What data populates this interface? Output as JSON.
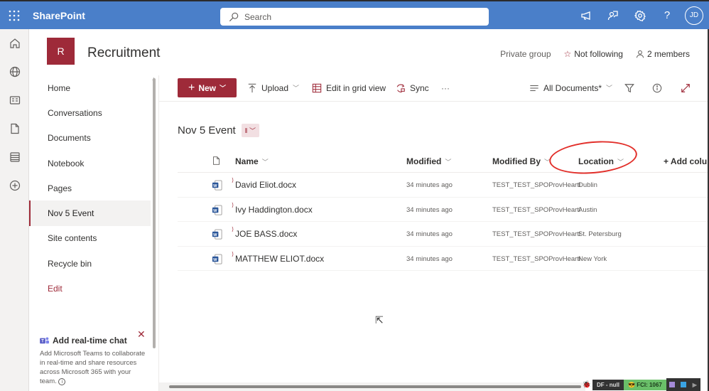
{
  "suitebar": {
    "app_name": "SharePoint",
    "search_placeholder": "Search",
    "icons": [
      "megaphone-icon",
      "feedback-icon",
      "settings-icon",
      "help-icon"
    ],
    "user_initials": "JD"
  },
  "site": {
    "logo_letter": "R",
    "title": "Recruitment",
    "privacy": "Private group",
    "follow_label": "Not following",
    "members_label": "2 members"
  },
  "appbar": {
    "icons": [
      "home-icon",
      "globe-icon",
      "news-icon",
      "file-icon",
      "list-icon",
      "add-circle-icon"
    ]
  },
  "leftnav": {
    "items": [
      {
        "label": "Home"
      },
      {
        "label": "Conversations"
      },
      {
        "label": "Documents"
      },
      {
        "label": "Notebook"
      },
      {
        "label": "Pages"
      },
      {
        "label": "Nov 5 Event",
        "selected": true
      },
      {
        "label": "Site contents"
      },
      {
        "label": "Recycle bin"
      },
      {
        "label": "Edit"
      }
    ],
    "chat_card": {
      "title": "Add real-time chat",
      "description": "Add Microsoft Teams to collaborate in real-time and share resources across Microsoft 365 with your team."
    }
  },
  "commandbar": {
    "new_label": "New",
    "upload_label": "Upload",
    "grid_label": "Edit in grid view",
    "sync_label": "Sync",
    "more_label": "···",
    "view_label": "All Documents*"
  },
  "library": {
    "title": "Nov 5 Event",
    "tag_icon": "library-icon",
    "columns": {
      "name": "Name",
      "modified": "Modified",
      "modified_by": "Modified By",
      "location": "Location",
      "add_column": "+ Add column"
    },
    "rows": [
      {
        "name": "David Eliot.docx",
        "modified": "34 minutes ago",
        "modified_by": "TEST_TEST_SPOProvHeartl",
        "location": "Dublin"
      },
      {
        "name": "Ivy Haddington.docx",
        "modified": "34 minutes ago",
        "modified_by": "TEST_TEST_SPOProvHeartl",
        "location": "Austin"
      },
      {
        "name": "JOE BASS.docx",
        "modified": "34 minutes ago",
        "modified_by": "TEST_TEST_SPOProvHeartl",
        "location": "St. Petersburg"
      },
      {
        "name": "MATTHEW ELIOT.docx",
        "modified": "34 minutes ago",
        "modified_by": "TEST_TEST_SPOProvHeartl",
        "location": "New York"
      }
    ]
  },
  "statusbar": {
    "df_label": "DF - null",
    "fci_label": "FCI: 1067"
  },
  "colors": {
    "suitebar": "#4a7fc9",
    "accent": "#9e2a39",
    "annotation": "#e22f2a"
  }
}
